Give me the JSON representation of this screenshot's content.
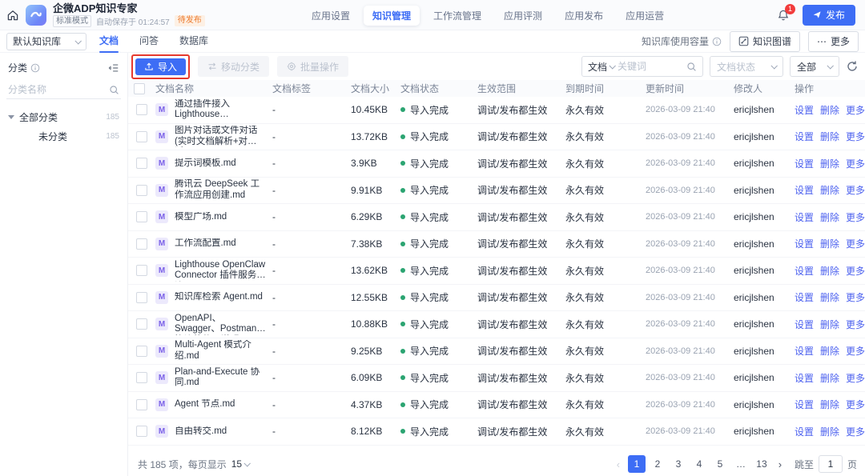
{
  "colors": {
    "accent": "#3D6DF5",
    "link": "#4D62EF",
    "success": "#2BA471",
    "warning": "#ED7B2F",
    "annotation": "#E6392E"
  },
  "header": {
    "title": "企微ADP知识专家",
    "mode_tag": "标准模式",
    "autosave_text": "自动保存于 01:24:57",
    "status_tag": "待发布",
    "nav": [
      {
        "label": "应用设置"
      },
      {
        "label": "知识管理",
        "active": true
      },
      {
        "label": "工作流管理"
      },
      {
        "label": "应用评测"
      },
      {
        "label": "应用发布"
      },
      {
        "label": "应用运营"
      }
    ],
    "notification_count": "1",
    "publish_label": "发布"
  },
  "kb_bar": {
    "kb_selector_value": "默认知识库",
    "tabs": [
      {
        "label": "文档",
        "active": true
      },
      {
        "label": "问答"
      },
      {
        "label": "数据库"
      }
    ],
    "capacity_label": "知识库使用容量",
    "graph_button_label": "知识图谱",
    "more_button_label": "更多",
    "more_ellipsis": "⋯"
  },
  "sidebar": {
    "title": "分类",
    "search_placeholder": "分类名称",
    "tree": [
      {
        "label": "全部分类",
        "count": "185",
        "has_caret": true
      },
      {
        "label": "未分类",
        "count": "185",
        "child": true
      }
    ]
  },
  "toolbar": {
    "import_label": "导入",
    "move_label": "移动分类",
    "batch_label": "批量操作",
    "search_scope_value": "文档",
    "search_placeholder": "关键词",
    "status_filter_placeholder": "文档状态",
    "scope_filter_value": "全部"
  },
  "table": {
    "columns": [
      "文档名称",
      "文档标签",
      "文档大小",
      "文档状态",
      "生效范围",
      "到期时间",
      "更新时间",
      "修改人",
      "操作"
    ],
    "action_labels": [
      "设置",
      "删除",
      "更多"
    ],
    "rows": [
      {
        "name": "通过插件接入 Lighthouse Openclaw.md",
        "tag": "-",
        "size": "10.45KB",
        "status": "导入完成",
        "scope": "调试/发布都生效",
        "expiry": "永久有效",
        "updated": "2026-03-09 21:40",
        "modifier": "ericjlshen"
      },
      {
        "name": "图片对话或文件对话(实时文档解析+对话).md",
        "tag": "-",
        "size": "13.72KB",
        "status": "导入完成",
        "scope": "调试/发布都生效",
        "expiry": "永久有效",
        "updated": "2026-03-09 21:40",
        "modifier": "ericjlshen"
      },
      {
        "name": "提示词模板.md",
        "tag": "-",
        "size": "3.9KB",
        "status": "导入完成",
        "scope": "调试/发布都生效",
        "expiry": "永久有效",
        "updated": "2026-03-09 21:40",
        "modifier": "ericjlshen"
      },
      {
        "name": "腾讯云 DeepSeek 工作流应用创建.md",
        "tag": "-",
        "size": "9.91KB",
        "status": "导入完成",
        "scope": "调试/发布都生效",
        "expiry": "永久有效",
        "updated": "2026-03-09 21:40",
        "modifier": "ericjlshen"
      },
      {
        "name": "模型广场.md",
        "tag": "-",
        "size": "6.29KB",
        "status": "导入完成",
        "scope": "调试/发布都生效",
        "expiry": "永久有效",
        "updated": "2026-03-09 21:40",
        "modifier": "ericjlshen"
      },
      {
        "name": "工作流配置.md",
        "tag": "-",
        "size": "7.38KB",
        "status": "导入完成",
        "scope": "调试/发布都生效",
        "expiry": "永久有效",
        "updated": "2026-03-09 21:40",
        "modifier": "ericjlshen"
      },
      {
        "name": "Lighthouse OpenClaw Connector 插件服务协议.md",
        "tag": "-",
        "size": "13.62KB",
        "status": "导入完成",
        "scope": "调试/发布都生效",
        "expiry": "永久有效",
        "updated": "2026-03-09 21:40",
        "modifier": "ericjlshen"
      },
      {
        "name": "知识库检索 Agent.md",
        "tag": "-",
        "size": "12.55KB",
        "status": "导入完成",
        "scope": "调试/发布都生效",
        "expiry": "永久有效",
        "updated": "2026-03-09 21:40",
        "modifier": "ericjlshen"
      },
      {
        "name": "OpenAPI、Swagger、Postman 协议的使用说明.md",
        "tag": "-",
        "size": "10.88KB",
        "status": "导入完成",
        "scope": "调试/发布都生效",
        "expiry": "永久有效",
        "updated": "2026-03-09 21:40",
        "modifier": "ericjlshen"
      },
      {
        "name": "Multi-Agent 模式介绍.md",
        "tag": "-",
        "size": "9.25KB",
        "status": "导入完成",
        "scope": "调试/发布都生效",
        "expiry": "永久有效",
        "updated": "2026-03-09 21:40",
        "modifier": "ericjlshen"
      },
      {
        "name": "Plan-and-Execute 协同.md",
        "tag": "-",
        "size": "6.09KB",
        "status": "导入完成",
        "scope": "调试/发布都生效",
        "expiry": "永久有效",
        "updated": "2026-03-09 21:40",
        "modifier": "ericjlshen"
      },
      {
        "name": "Agent 节点.md",
        "tag": "-",
        "size": "4.37KB",
        "status": "导入完成",
        "scope": "调试/发布都生效",
        "expiry": "永久有效",
        "updated": "2026-03-09 21:40",
        "modifier": "ericjlshen"
      },
      {
        "name": "自由转交.md",
        "tag": "-",
        "size": "8.12KB",
        "status": "导入完成",
        "scope": "调试/发布都生效",
        "expiry": "永久有效",
        "updated": "2026-03-09 21:40",
        "modifier": "ericjlshen"
      }
    ]
  },
  "footer": {
    "total_text": "共 185 项，每页显示",
    "page_size": "15",
    "pages": [
      {
        "n": "1",
        "active": true
      },
      {
        "n": "2"
      },
      {
        "n": "3"
      },
      {
        "n": "4"
      },
      {
        "n": "5"
      },
      {
        "n": "…",
        "dots": true
      },
      {
        "n": "13"
      }
    ],
    "prev_label": "‹",
    "next_label": "›",
    "jump_label": "跳至",
    "jump_value": "1",
    "jump_suffix": "页"
  }
}
